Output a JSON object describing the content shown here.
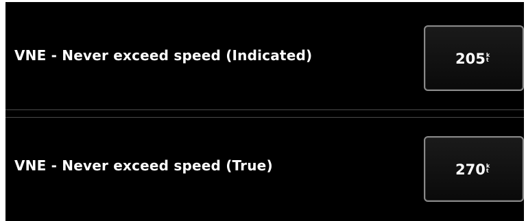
{
  "settings": [
    {
      "label": "VNE - Never exceed speed (Indicated)",
      "value": "205",
      "unit_top": "k",
      "unit_bottom": "t"
    },
    {
      "label": "VNE - Never exceed speed (True)",
      "value": "270",
      "unit_top": "k",
      "unit_bottom": "t"
    }
  ],
  "colors": {
    "background": "#000000",
    "text": "#ffffff",
    "button_border": "#8a8a8a"
  }
}
